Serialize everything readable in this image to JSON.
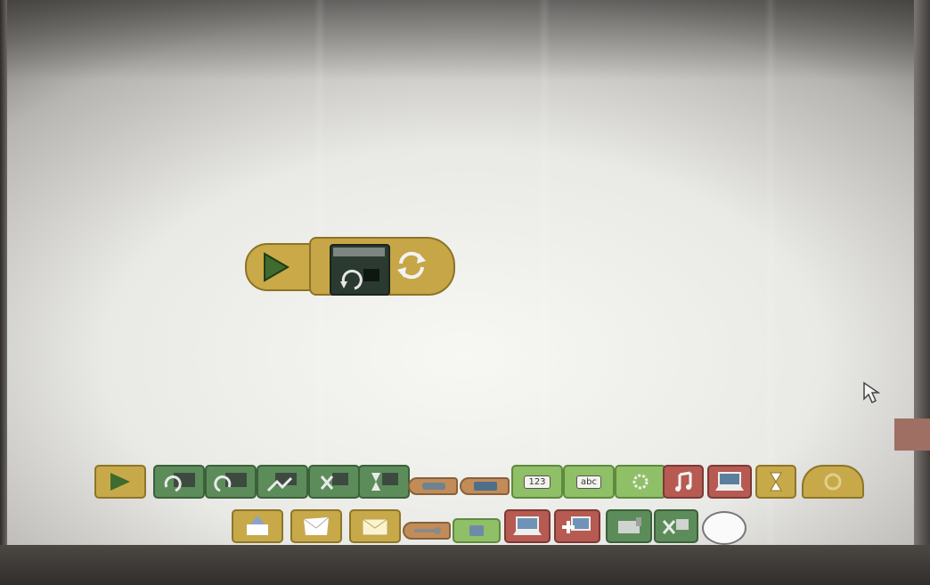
{
  "colors": {
    "flow_yellow": "#c7a94a",
    "action_green": "#5c8c5a",
    "sensor_light_green": "#8fbf66",
    "display_red": "#b65a52",
    "variable_tan": "#c28c58"
  },
  "canvas": {
    "program_blocks": [
      {
        "icon": "play-icon",
        "type": "start"
      },
      {
        "icon": "motor-rotate-icon",
        "type": "motor"
      },
      {
        "icon": "loop-icon",
        "type": "loop"
      }
    ]
  },
  "palette": {
    "row1": [
      {
        "icon": "play-icon"
      },
      {
        "icon": "motor-cw-icon"
      },
      {
        "icon": "motor-ccw-icon"
      },
      {
        "icon": "motor-power-icon"
      },
      {
        "icon": "motor-off-icon"
      },
      {
        "icon": "motor-time-icon"
      },
      {
        "icon": "tilt-sensor-icon"
      },
      {
        "icon": "distance-sensor-icon"
      },
      {
        "icon": "number-input-icon",
        "label": "123"
      },
      {
        "icon": "text-input-icon",
        "label": "abc"
      },
      {
        "icon": "random-icon"
      },
      {
        "icon": "sound-icon"
      },
      {
        "icon": "display-icon"
      },
      {
        "icon": "wait-icon"
      },
      {
        "icon": "loop-icon"
      }
    ],
    "row2": [
      {
        "icon": "receive-message-icon"
      },
      {
        "icon": "send-message-icon"
      },
      {
        "icon": "message-icon"
      },
      {
        "icon": "key-icon"
      },
      {
        "icon": "light-sensor-icon"
      },
      {
        "icon": "display-background-icon"
      },
      {
        "icon": "display-add-icon"
      },
      {
        "icon": "motor-on-icon"
      },
      {
        "icon": "motor-stop-icon"
      },
      {
        "icon": "comment-icon"
      }
    ]
  }
}
